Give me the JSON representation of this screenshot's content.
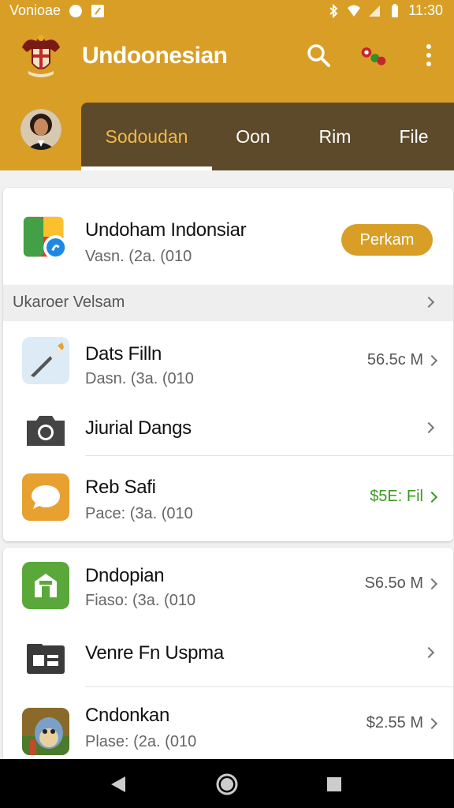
{
  "status_bar": {
    "carrier": "Vonioae",
    "time": "11:30"
  },
  "app": {
    "title": "Undoonesian"
  },
  "tabs": [
    {
      "label": "Sodoudan",
      "active": true
    },
    {
      "label": "Oon",
      "active": false
    },
    {
      "label": "Rim",
      "active": false
    },
    {
      "label": "File",
      "active": false
    }
  ],
  "featured": {
    "title": "Undoham Indonsiar",
    "subtitle": "Vasn. (2a. (010",
    "button": "Perkam"
  },
  "section": {
    "label": "Ukaroer Velsam"
  },
  "list_card_1": [
    {
      "title": "Dats Filln",
      "subtitle": "Dasn. (3a. (010",
      "meta": "56.5c M",
      "icon": "pencil-icon"
    },
    {
      "title": "Jiurial Dangs",
      "icon": "camera-icon"
    },
    {
      "title": "Reb Safi",
      "subtitle": "Pace: (3a. (010",
      "meta": "$5E: Fil",
      "icon": "chat-icon",
      "meta_color": "#3b9a20"
    }
  ],
  "list_card_2": [
    {
      "title": "Dndopian",
      "subtitle": "Fiaso: (3a. (010",
      "meta": "S6.5o M",
      "icon": "store-icon"
    },
    {
      "title": "Venre Fn Uspma",
      "icon": "id-card-icon"
    },
    {
      "title": "Cndonkan",
      "subtitle": "Plase: (2a. (010",
      "meta": "$2.55 M",
      "icon": "game-character-icon"
    }
  ],
  "colors": {
    "primary": "#d89e26",
    "tab_bg": "#5d4a2a",
    "tab_active": "#f2b94a",
    "green": "#3b9a20"
  }
}
